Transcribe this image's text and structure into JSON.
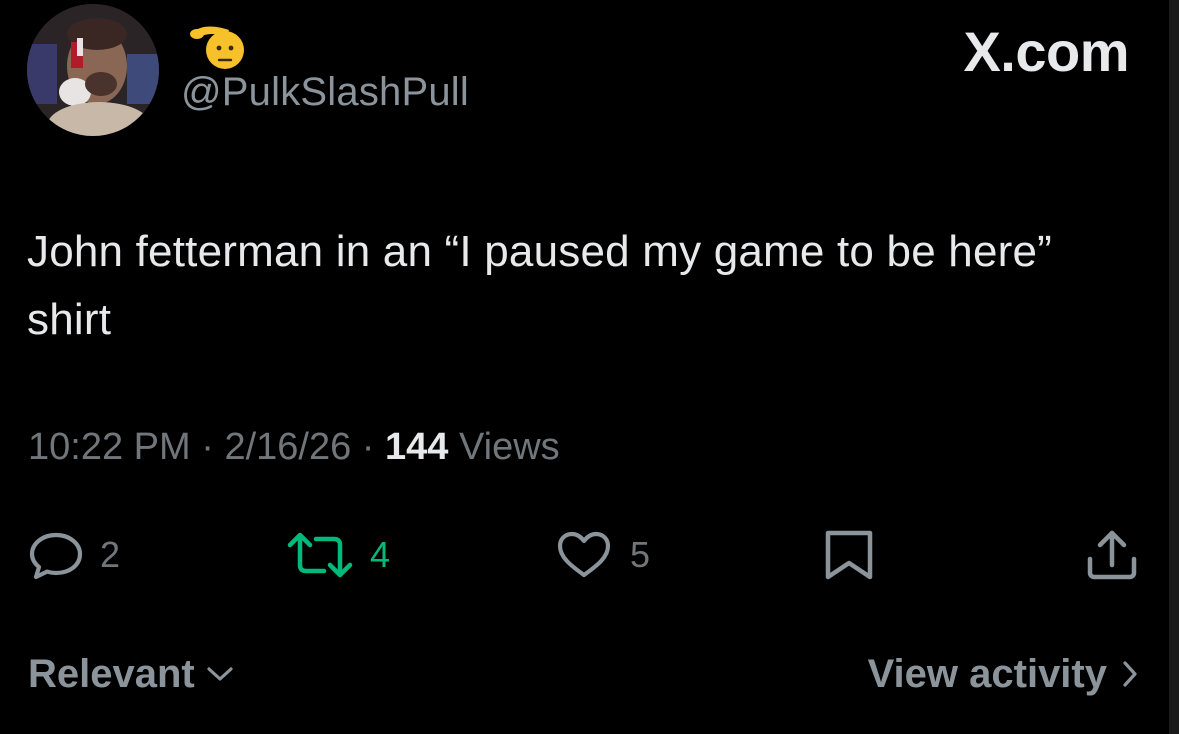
{
  "post": {
    "handle": "@PulkSlashPull",
    "brand": "X.com",
    "text": "John fetterman in an “I paused my game to be here” shirt",
    "time": "10:22 PM",
    "date": "2/16/26",
    "views_count": "144",
    "views_label": "Views",
    "display_name_icon": "saluting-face-emoji",
    "avatar_icon": "user-avatar-photo"
  },
  "actions": {
    "replies": "2",
    "reposts": "4",
    "likes": "5"
  },
  "footer": {
    "sort_label": "Relevant",
    "activity_label": "View activity"
  },
  "colors": {
    "background": "#000000",
    "text_primary": "#e7e9ea",
    "text_secondary": "#71767b",
    "repost_active": "#00ba7c"
  }
}
